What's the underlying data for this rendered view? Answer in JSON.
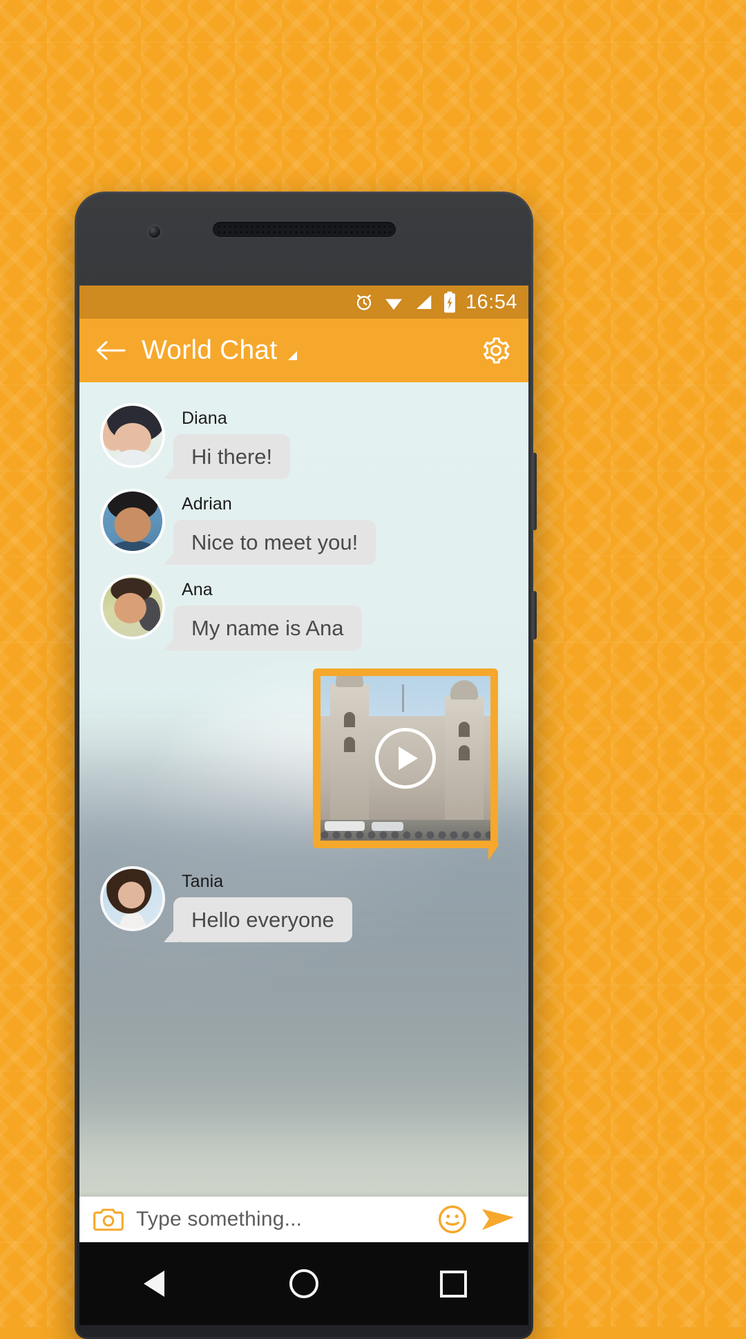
{
  "theme": {
    "backdrop": "#f6a623",
    "accent": "#f6a82c",
    "statusbar_bg": "#cf8a20",
    "bubble_bg": "#e4e4e4",
    "bubble_text": "#4a4a4a"
  },
  "statusbar": {
    "time": "16:54",
    "icons": [
      "alarm-icon",
      "wifi-icon",
      "signal-icon",
      "battery-charging-icon"
    ]
  },
  "appbar": {
    "back_label": "←",
    "title": "World Chat",
    "dropdown_icon": "caret-down-icon",
    "settings_icon": "gear-icon"
  },
  "messages": [
    {
      "sender": "Diana",
      "text": "Hi there!",
      "type": "text"
    },
    {
      "sender": "Adrian",
      "text": "Nice to meet you!",
      "type": "text"
    },
    {
      "sender": "Ana",
      "text": "My name is Ana",
      "type": "text"
    },
    {
      "sender": "",
      "text": "",
      "type": "video",
      "play_icon": "play-icon"
    },
    {
      "sender": "Tania",
      "text": "Hello everyone",
      "type": "text"
    }
  ],
  "composer": {
    "camera_icon": "camera-icon",
    "placeholder": "Type something...",
    "emoji_icon": "smiley-icon",
    "send_icon": "send-icon"
  },
  "navbar": {
    "back": "back-triangle-icon",
    "home": "home-circle-icon",
    "recents": "recents-square-icon"
  }
}
